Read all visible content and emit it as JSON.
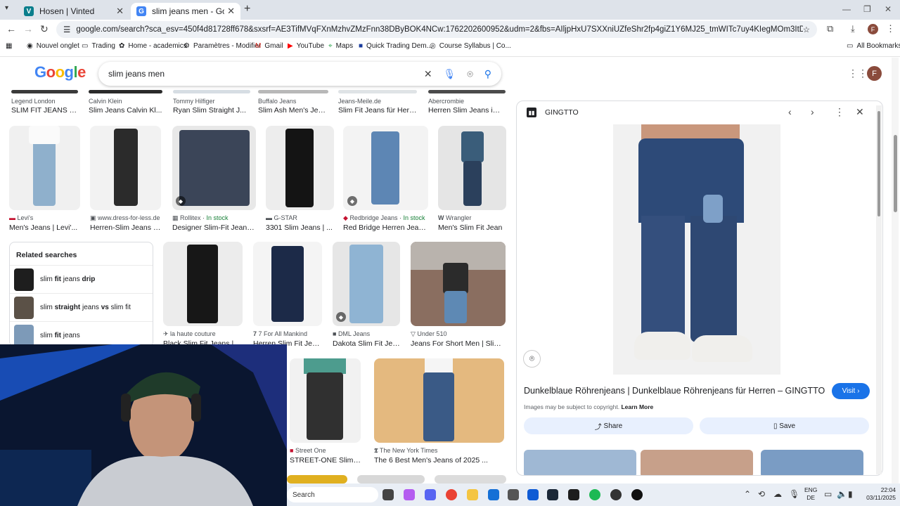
{
  "browser": {
    "tabs": [
      {
        "title": "Hosen | Vinted",
        "favicon": "V",
        "color": "#0a7e8c"
      },
      {
        "title": "slim jeans men - Google Search",
        "favicon": "G",
        "color": "#4285f4"
      }
    ],
    "url": "google.com/search?sca_esv=450f4d81728ff678&sxsrf=AE3TifMVqFXnMzhvZMzFnn38DByBOK4NCw:1762202600952&udm=2&fbs=AIljpHxU7SXXniUZfeShr2fp4giZ1Y6MJ25_tmWITc7uy4KIegMOm3ItDJ-cT-Q5w0bTw0Yk9lyVRKECF3QV6b4wfD8vumIc...",
    "bookmarks": [
      "Nouvel onglet",
      "Trading",
      "Home - academics",
      "Paramètres - Modifier",
      "Gmail",
      "YouTube",
      "Maps",
      "Quick Trading Dem...",
      "Course Syllabus | Co..."
    ],
    "all_bookmarks": "All Bookmarks",
    "profile_initial": "F"
  },
  "google": {
    "logo": "Google",
    "query": "slim jeans men",
    "profile_initial": "F"
  },
  "results": {
    "row0": [
      {
        "source": "Legend London",
        "caption": "SLIM FIT JEANS 2..."
      },
      {
        "source": "Calvin Klein",
        "caption": "Slim Jeans Calvin Kl..."
      },
      {
        "source": "Tommy Hilfiger",
        "caption": "Ryan Slim Straight J..."
      },
      {
        "source": "Buffalo Jeans",
        "caption": "Slim Ash Men's Jea..."
      },
      {
        "source": "Jeans-Meile.de",
        "caption": "Slim Fit Jeans für Herr..."
      },
      {
        "source": "Abercrombie",
        "caption": "Herren Slim Jeans im ..."
      }
    ],
    "row1": [
      {
        "source": "Levi's",
        "stock": "",
        "caption": "Men's Jeans | Levi'..."
      },
      {
        "source": "www.dress-for-less.de",
        "stock": "",
        "caption": "Herren-Slim Jeans | ..."
      },
      {
        "source": "Rollitex",
        "stock": "In stock",
        "caption": "Designer Slim-Fit Jeans ..."
      },
      {
        "source": "G-STAR",
        "stock": "",
        "caption": "3301 Slim Jeans | ..."
      },
      {
        "source": "Redbridge Jeans",
        "stock": "In stock",
        "caption": "Red Bridge Herren Jean..."
      },
      {
        "source": "Wrangler",
        "stock": "",
        "caption": "Men's Slim Fit Jean"
      }
    ],
    "row2": [
      {
        "source": "la haute couture",
        "caption": "Black Slim Fit Jeans | ..."
      },
      {
        "source": "7 For All Mankind",
        "caption": "Herren Slim Fit Jea..."
      },
      {
        "source": "DML Jeans",
        "caption": "Dakota Slim Fit Jea..."
      },
      {
        "source": "Under 510",
        "caption": "Jeans For Short Men | Slim ..."
      }
    ],
    "row3": [
      {
        "source": "Street One",
        "caption": "STREET-ONE Slim ..."
      },
      {
        "source": "The New York Times",
        "caption": "The 6 Best Men's Jeans of 2025 ..."
      }
    ]
  },
  "related": {
    "heading": "Related searches",
    "items": [
      {
        "pre": "slim ",
        "b1": "fit",
        "mid": " jeans ",
        "b2": "drip",
        "post": ""
      },
      {
        "pre": "slim ",
        "b1": "straight",
        "mid": " jeans ",
        "b2": "vs",
        "post": " slim fit"
      },
      {
        "pre": "slim ",
        "b1": "fit",
        "mid": " jeans",
        "b2": "",
        "post": ""
      }
    ]
  },
  "preview": {
    "site": "GINGTTO",
    "title": "Dunkelblaue Röhrenjeans | Dunkelblaue Röhrenjeans für Herren – GINGTTO",
    "visit": "Visit",
    "copyright": "Images may be subject to copyright.",
    "learn_more": "Learn More",
    "share": "Share",
    "save": "Save"
  },
  "taskbar": {
    "search_placeholder": "Search",
    "lang_top": "ENG",
    "lang_bottom": "DE",
    "time": "22:04",
    "date": "03/11/2025"
  },
  "colors": {
    "accent": "#1a73e8",
    "in_stock": "#188038"
  }
}
